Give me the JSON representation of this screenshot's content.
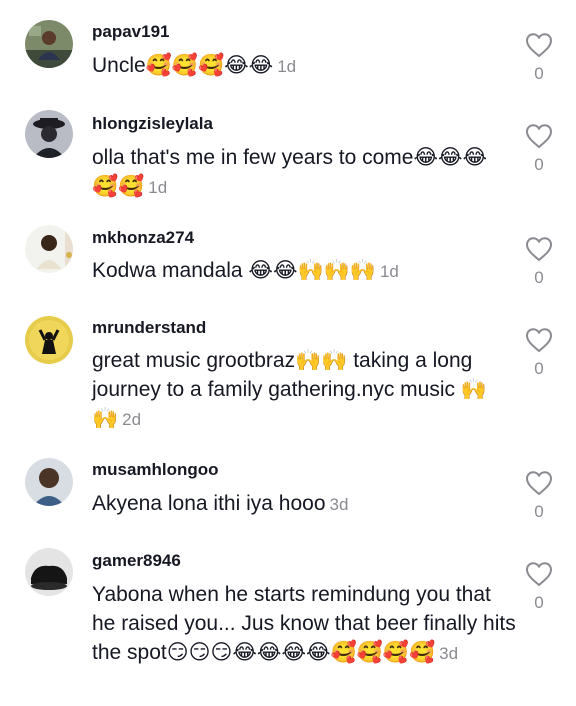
{
  "comments": [
    {
      "username": "papav191",
      "text": "Uncle🥰🥰🥰😂😂",
      "time": "1d",
      "likes": "0"
    },
    {
      "username": "hlongzisleylala",
      "text": "olla that's me in few years to come😂😂😂🥰🥰",
      "time": "1d",
      "likes": "0"
    },
    {
      "username": "mkhonza274",
      "text": "Kodwa mandala 😂😂🙌🙌🙌",
      "time": "1d",
      "likes": "0"
    },
    {
      "username": "mrunderstand",
      "text": "great music grootbraz🙌🙌 taking a long journey to a family gathering.nyc music 🙌🙌",
      "time": "2d",
      "likes": "0"
    },
    {
      "username": "musamhlongoo",
      "text": "Akyena lona ithi iya hooo",
      "time": "3d",
      "likes": "0"
    },
    {
      "username": "gamer8946",
      "text": "Yabona when he starts remindung you that he raised you... Jus know that beer finally hits the spot😏😏😏😂😂😂😂🥰🥰🥰🥰",
      "time": "3d",
      "likes": "0"
    }
  ],
  "icons": {
    "like": "heart-outline-icon"
  },
  "colors": {
    "text": "#161823",
    "secondary": "#8a8b91"
  }
}
